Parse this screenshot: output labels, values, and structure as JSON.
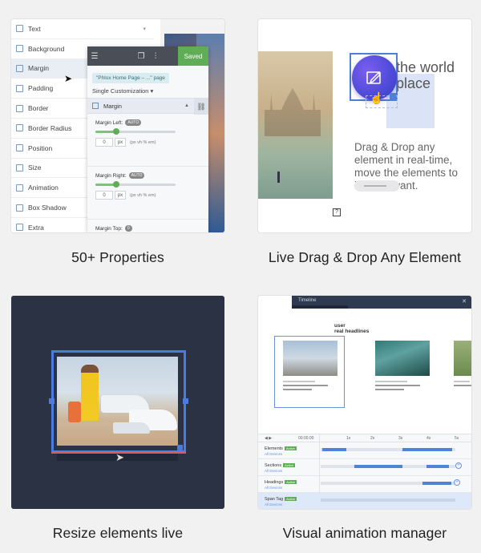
{
  "features": [
    {
      "caption": "50+ Properties"
    },
    {
      "caption": "Live Drag & Drop Any Element"
    },
    {
      "caption": "Resize elements live"
    },
    {
      "caption": "Visual animation manager"
    }
  ],
  "properties_card": {
    "items": [
      {
        "label": "Text",
        "icon": "text-icon"
      },
      {
        "label": "Background",
        "icon": "background-icon"
      },
      {
        "label": "Margin",
        "icon": "margin-icon"
      },
      {
        "label": "Padding",
        "icon": "padding-icon"
      },
      {
        "label": "Border",
        "icon": "border-icon"
      },
      {
        "label": "Border Radius",
        "icon": "border-radius-icon"
      },
      {
        "label": "Position",
        "icon": "position-icon"
      },
      {
        "label": "Size",
        "icon": "size-icon"
      },
      {
        "label": "Animation",
        "icon": "animation-icon"
      },
      {
        "label": "Box Shadow",
        "icon": "box-shadow-icon"
      },
      {
        "label": "Extra",
        "icon": "extra-icon"
      }
    ],
    "active_item": "Margin",
    "panel": {
      "saved_label": "Saved",
      "page_tag": "\"Phlox Home Page – ...\" page",
      "customization": "Single Customization",
      "section_title": "Margin",
      "fields": [
        {
          "label": "Margin Left:",
          "badge": "AUTO",
          "value": "0",
          "unit": "px",
          "units_hint": "(px vh % em)"
        },
        {
          "label": "Margin Right:",
          "badge": "AUTO",
          "value": "0",
          "unit": "px",
          "units_hint": "(px vh % em)"
        },
        {
          "label": "Margin Top:",
          "badge": "0"
        }
      ]
    }
  },
  "dragdrop_card": {
    "heading": "the world\nplace",
    "body": "Drag & Drop any element in real-time, move the elements to     ion you want.",
    "help": "?"
  },
  "animation_card": {
    "header": "Timeline",
    "section_title": "user\nreal headlines",
    "ruler": [
      "00:00.00",
      "1s",
      "2s",
      "3s",
      "4s",
      "5s"
    ],
    "rows": [
      {
        "name": "Elements",
        "sub": "All Devices",
        "badge": "Active"
      },
      {
        "name": "Sections",
        "sub": "All Devices",
        "badge": "Active"
      },
      {
        "name": "Headings",
        "sub": "All Devices",
        "badge": "Active"
      },
      {
        "name": "Span Tag",
        "sub": "All Devices",
        "badge": "Active"
      }
    ]
  },
  "colors": {
    "accent_green": "#5fae57",
    "selection_blue": "#4a7be0",
    "resize_bg": "#2a3244"
  }
}
